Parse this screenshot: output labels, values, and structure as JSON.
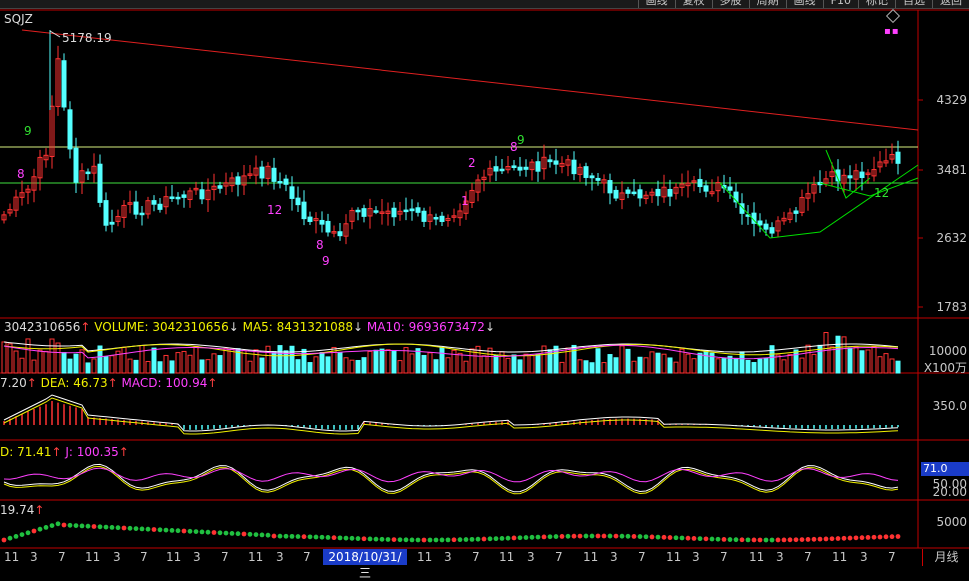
{
  "toolbar": {
    "buttons": [
      "画线",
      "复权",
      "多股",
      "周期",
      "画线",
      "F10",
      "标记",
      "自选",
      "返回"
    ]
  },
  "main": {
    "symbol": "SQJZ",
    "max_price_label": "5178.19",
    "price_axis": [
      "4329",
      "3481",
      "2632",
      "1783"
    ],
    "td_marks": [
      "9",
      "8",
      "2",
      "8",
      "9",
      "12",
      "8",
      "9",
      "1",
      "12"
    ]
  },
  "volume": {
    "label_value": "3042310656",
    "volume_label": "VOLUME: 3042310656",
    "ma5_label": "MA5: 8431321088",
    "ma10_label": "MA10: 9693673472",
    "axis_tick": "10000",
    "axis_unit": "X100万"
  },
  "macd": {
    "dif_label": "7.20",
    "dea_label": "DEA: 46.73",
    "macd_label": "MACD: 100.94",
    "axis_tick": "350.0"
  },
  "kdj": {
    "d_label": "D: 71.41",
    "j_label": "J: 100.35",
    "current_value": "71.0",
    "axis_ticks": [
      "50.00",
      "20.00"
    ]
  },
  "bottom": {
    "label": "19.74",
    "axis_tick": "5000"
  },
  "x_axis": {
    "ticks": [
      "11",
      "3",
      "7",
      "11",
      "3",
      "7",
      "11",
      "3",
      "7",
      "11",
      "3",
      "7",
      "11",
      "3",
      "7",
      "11",
      "3",
      "7",
      "11",
      "3",
      "7",
      "11",
      "3",
      "7",
      "11",
      "3",
      "7",
      "11",
      "3",
      "7"
    ],
    "cursor_date": "2018/10/31/三",
    "period": "月线"
  },
  "colors": {
    "up": "#ff3232",
    "down": "#54ffff",
    "ma_white": "#ffffff",
    "ma_yellow": "#f0f000",
    "ma_magenta": "#ff40ff",
    "trend_red": "#e02020",
    "level_line": "#d8f080",
    "support_green": "#00e000"
  }
}
